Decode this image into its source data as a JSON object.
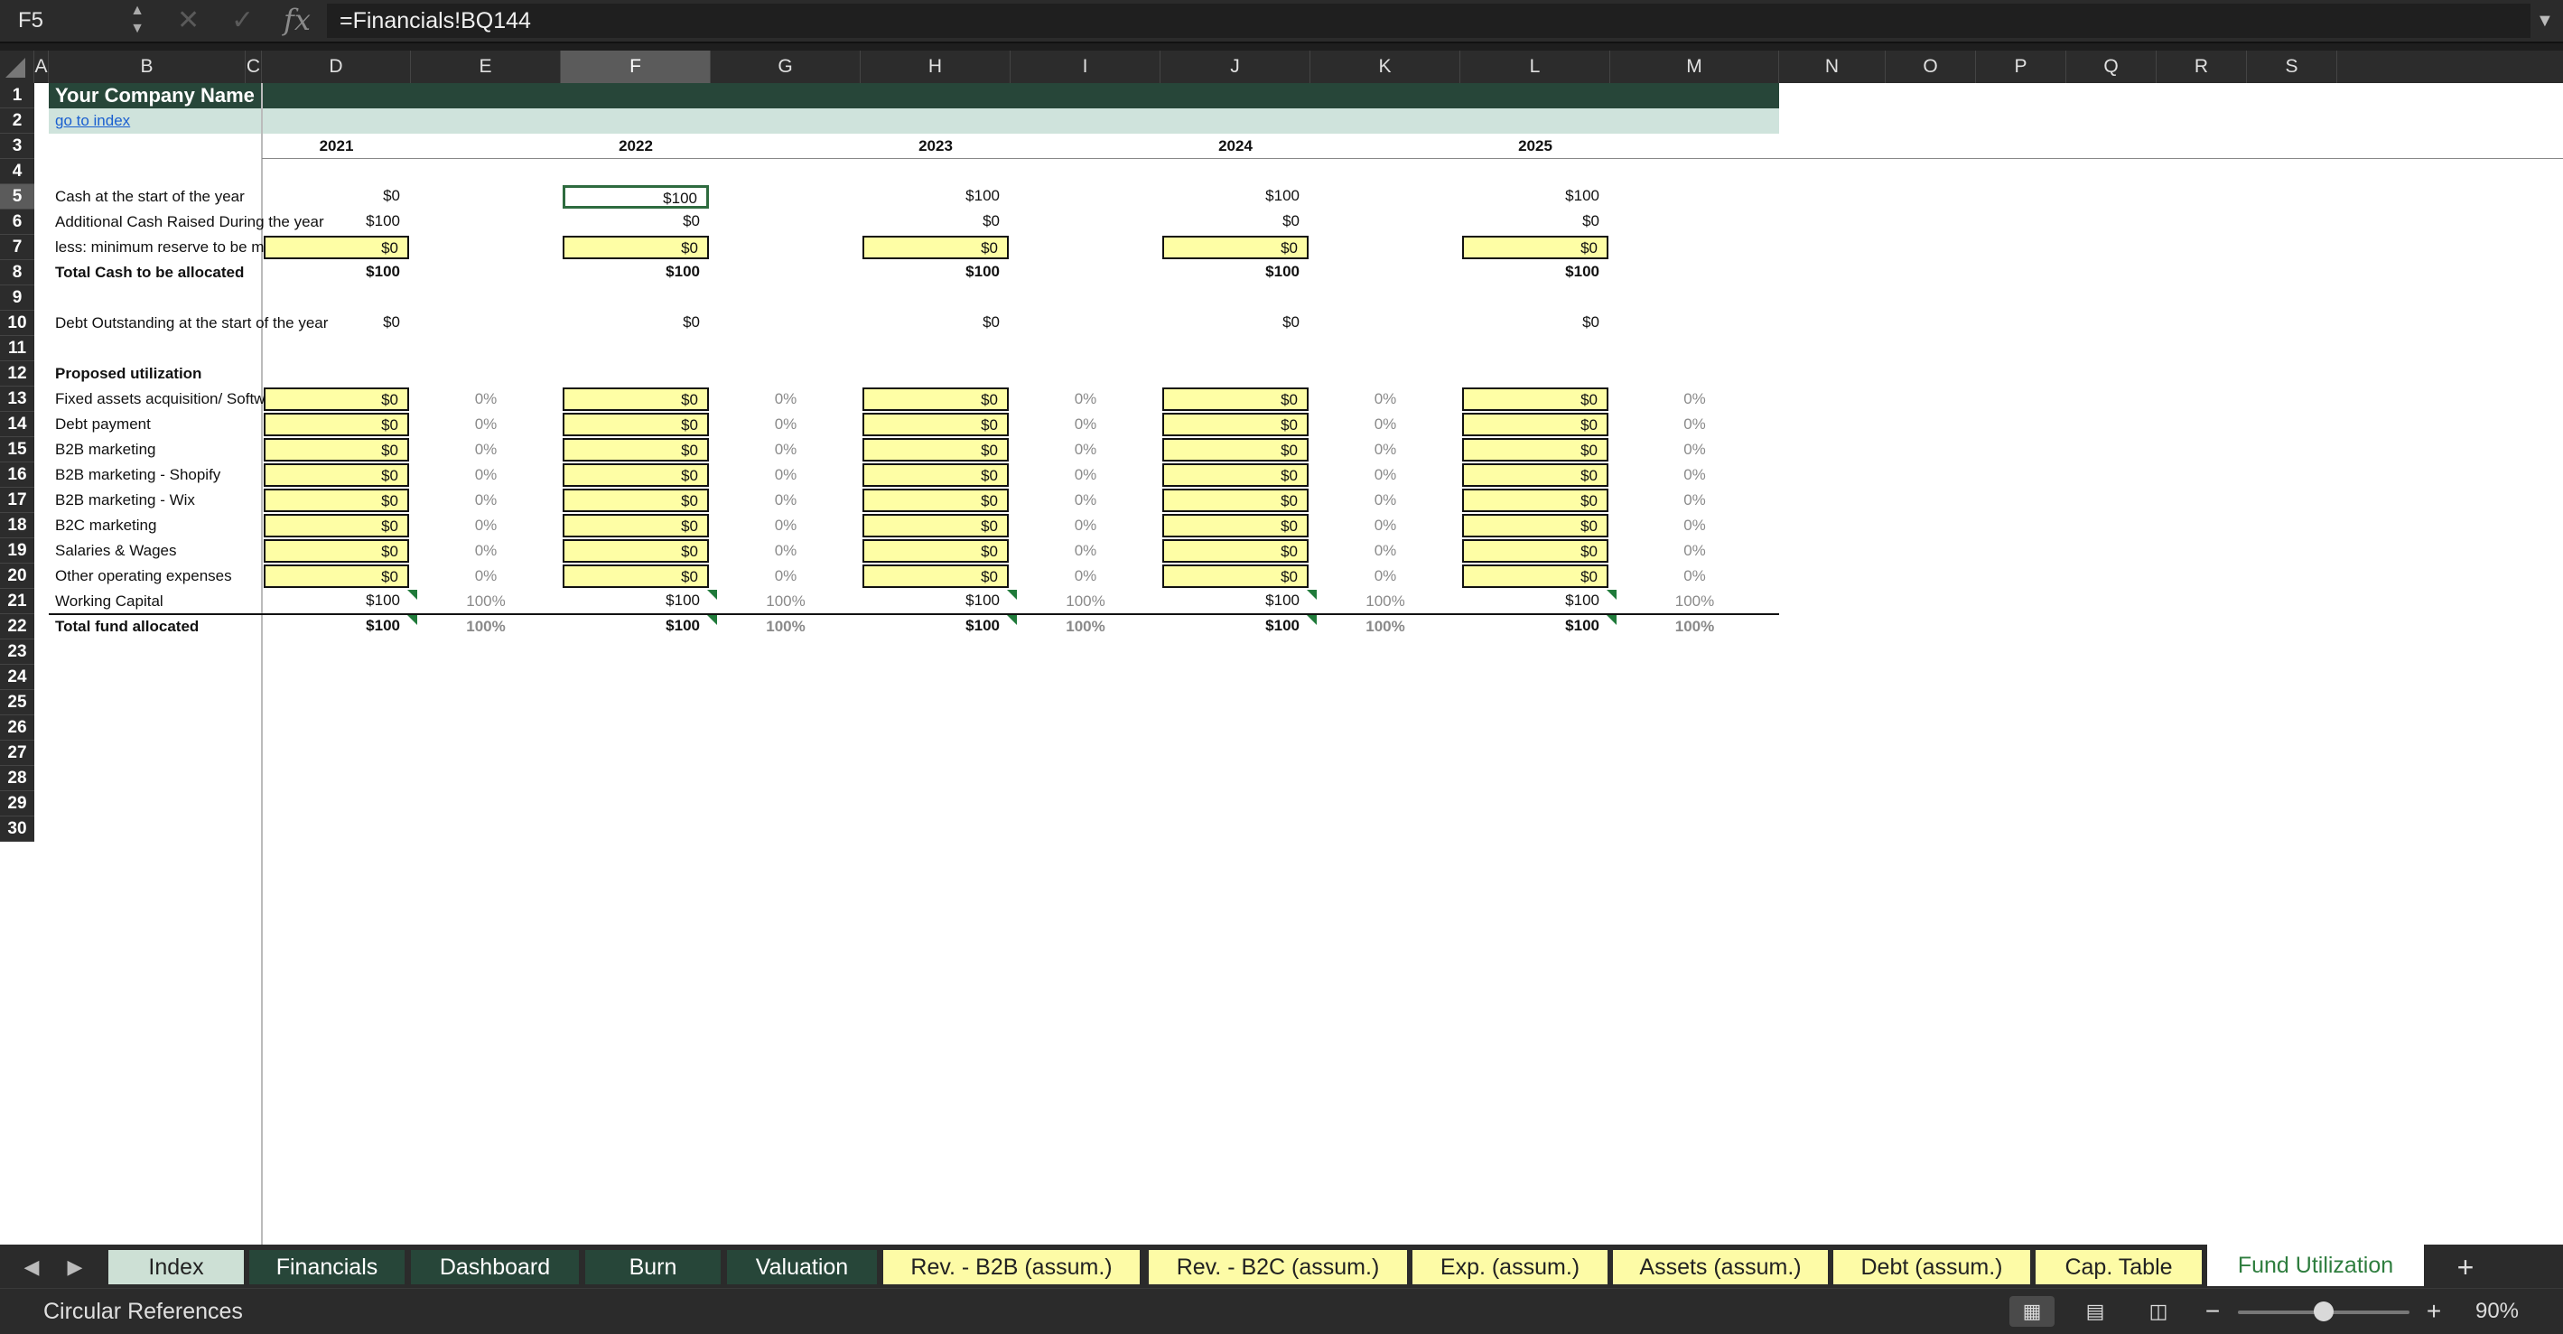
{
  "formula_bar": {
    "cell_ref": "F5",
    "formula": "=Financials!BQ144"
  },
  "columns": [
    "A",
    "B",
    "C",
    "D",
    "E",
    "F",
    "G",
    "H",
    "I",
    "J",
    "K",
    "L",
    "M",
    "N",
    "O",
    "P",
    "Q",
    "R",
    "S"
  ],
  "selected_column": "F",
  "rows": [
    "1",
    "2",
    "3",
    "4",
    "5",
    "6",
    "7",
    "8",
    "9",
    "10",
    "11",
    "12",
    "13",
    "14",
    "15",
    "16",
    "17",
    "18",
    "19",
    "20",
    "21",
    "22",
    "23",
    "24",
    "25",
    "26",
    "27",
    "28",
    "29",
    "30"
  ],
  "selected_row": "5",
  "sheet": {
    "company": "Your Company Name",
    "index_link": "go to index",
    "years": [
      "2021",
      "2022",
      "2023",
      "2024",
      "2025"
    ],
    "labels": {
      "cash_start": "Cash at the start of the year",
      "add_cash": "Additional Cash Raised During the year",
      "min_reserve": "less: minimum reserve to be maintained",
      "total_cash": "Total Cash to be allocated",
      "debt_out": "Debt Outstanding at the start of the year",
      "proposed": "Proposed utilization",
      "fixed_assets": "Fixed assets acquisition/ Software build-up",
      "debt_payment": "Debt payment",
      "b2b_marketing": "B2B marketing",
      "b2b_shopify": "B2B marketing - Shopify",
      "b2b_wix": "B2B marketing - Wix",
      "b2c_marketing": "B2C marketing",
      "salaries": "Salaries & Wages",
      "other_opex": "Other operating expenses",
      "working_capital": "Working Capital",
      "total_fund": "Total fund allocated"
    },
    "values": {
      "cash_start": [
        "$0",
        "$100",
        "$100",
        "$100",
        "$100"
      ],
      "add_cash": [
        "$100",
        "$0",
        "$0",
        "$0",
        "$0"
      ],
      "min_reserve": [
        "$0",
        "$0",
        "$0",
        "$0",
        "$0"
      ],
      "total_cash": [
        "$100",
        "$100",
        "$100",
        "$100",
        "$100"
      ],
      "debt_out": [
        "$0",
        "$0",
        "$0",
        "$0",
        "$0"
      ],
      "util_value": "$0",
      "util_pct": "0%",
      "working_capital": "$100",
      "working_capital_pct": "100%",
      "total_fund": "$100",
      "total_fund_pct": "100%"
    }
  },
  "tabs": [
    {
      "label": "Index",
      "style": "idx"
    },
    {
      "label": "Financials",
      "style": "dg"
    },
    {
      "label": "Dashboard",
      "style": "dg"
    },
    {
      "label": "Burn",
      "style": "dg"
    },
    {
      "label": "Valuation",
      "style": "dg"
    },
    {
      "label": "Rev. - B2B (assum.)",
      "style": "yl"
    },
    {
      "label": "Rev. - B2C (assum.)",
      "style": "yl"
    },
    {
      "label": "Exp. (assum.)",
      "style": "yl"
    },
    {
      "label": "Assets (assum.)",
      "style": "yl"
    },
    {
      "label": "Debt (assum.)",
      "style": "yl"
    },
    {
      "label": "Cap. Table",
      "style": "yl"
    },
    {
      "label": "Fund Utilization",
      "style": "act"
    }
  ],
  "add_sheet": "+",
  "status": {
    "text": "Circular References",
    "zoom_out": "−",
    "zoom_in": "+",
    "zoom": "90%",
    "zoom_level": 0.5
  },
  "colors": {
    "header_dark": "#274639",
    "header_light": "#cfe3dc",
    "input_yellow": "#fefea5",
    "active_tab_text": "#2e7d3e"
  }
}
